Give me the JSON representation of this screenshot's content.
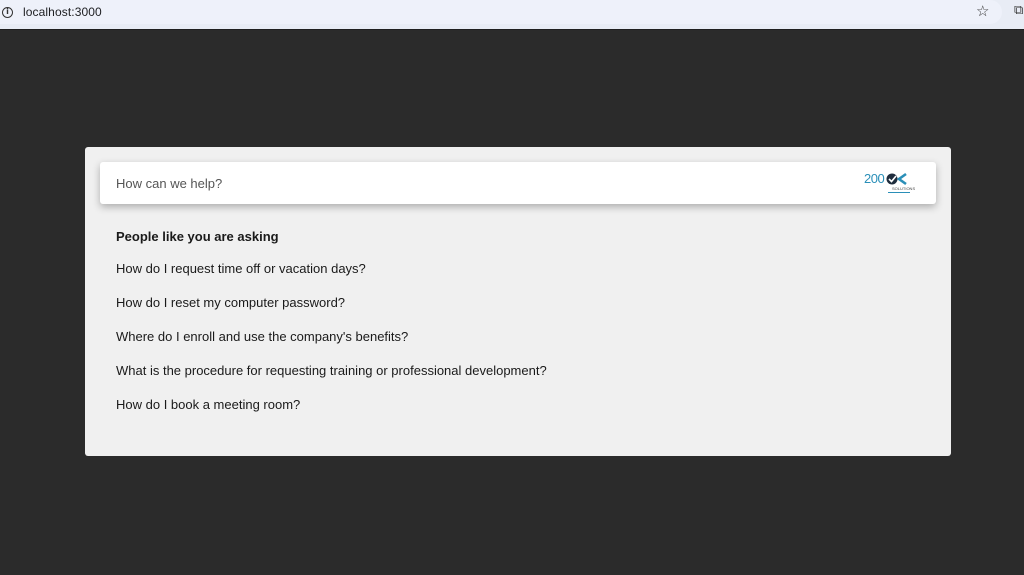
{
  "browser": {
    "url": "localhost:3000",
    "info_icon": "info-icon",
    "bookmark_icon": "star-icon",
    "extensions_icon": "puzzle-icon"
  },
  "search": {
    "placeholder": "How can we help?",
    "value": ""
  },
  "logo": {
    "number": "200",
    "subtitle": "SOLUTIONS"
  },
  "suggestions": {
    "heading": "People like you are asking",
    "items": [
      "How do I request time off or vacation days?",
      "How do I reset my computer password?",
      "Where do I enroll and use the company's benefits?",
      "What is the procedure for requesting training or professional development?",
      "How do I book a meeting room?"
    ]
  },
  "colors": {
    "page_background": "#2b2b2b",
    "card_background": "#f0f0f0",
    "brand_blue": "#2a8fb8",
    "brand_dark": "#1f2d3d"
  }
}
